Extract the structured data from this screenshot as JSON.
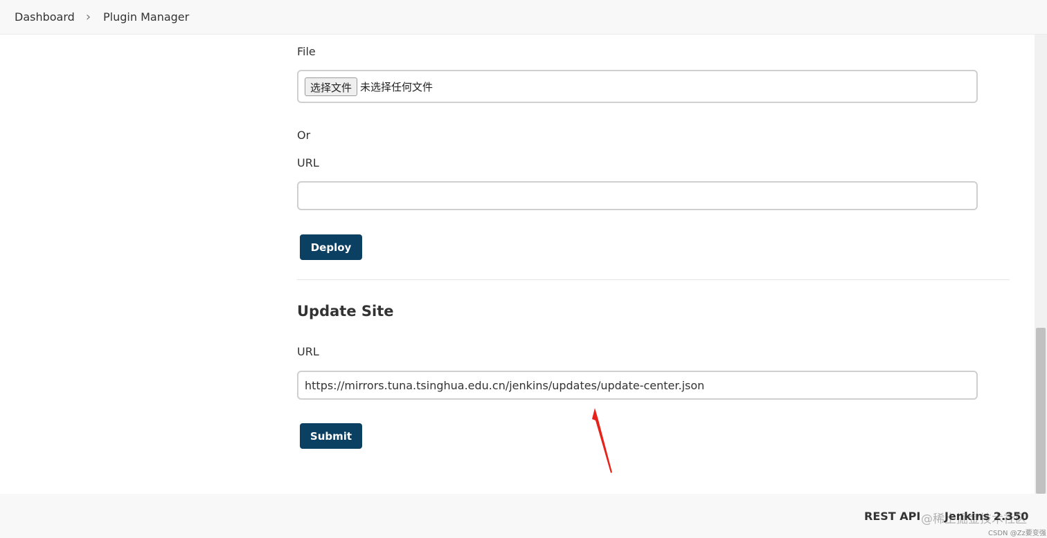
{
  "breadcrumb": {
    "items": [
      "Dashboard",
      "Plugin Manager"
    ],
    "separator": "›"
  },
  "deploy": {
    "file_label": "File",
    "file_button": "选择文件",
    "file_status": "未选择任何文件",
    "or_text": "Or",
    "url_label": "URL",
    "url_value": "",
    "button": "Deploy"
  },
  "update_site": {
    "title": "Update Site",
    "url_label": "URL",
    "url_value": "https://mirrors.tuna.tsinghua.edu.cn/jenkins/updates/update-center.json",
    "button": "Submit"
  },
  "footer": {
    "rest_api": "REST API",
    "version": "Jenkins 2.350",
    "watermark": "@稀土掘金技术社区",
    "watermark_small": "CSDN @Zz要变强"
  },
  "colors": {
    "button_bg": "#0b4063",
    "arrow": "#e5231b"
  }
}
